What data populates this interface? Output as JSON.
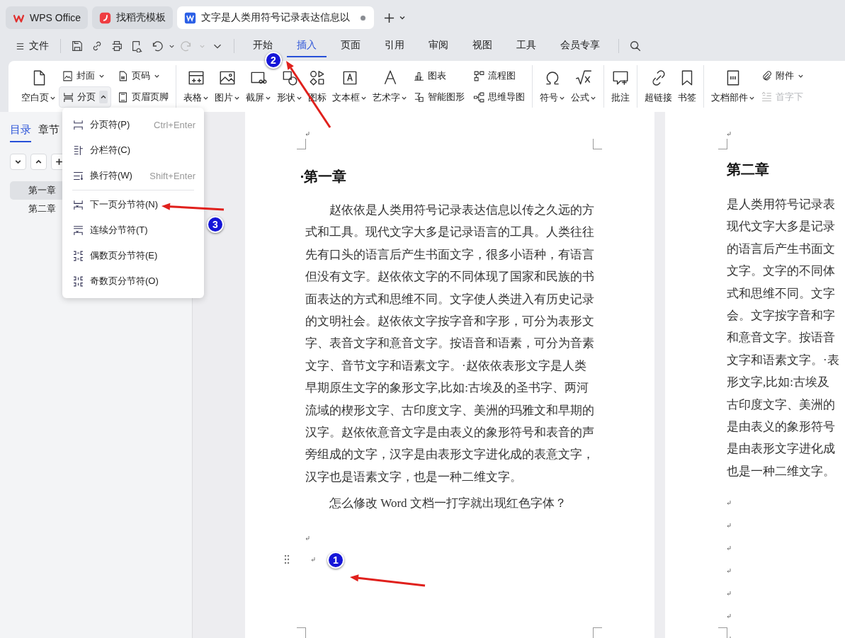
{
  "title_tabs": [
    {
      "label": "WPS Office",
      "selected": false,
      "unsaved": false
    },
    {
      "label": "找稻壳模板",
      "selected": false,
      "unsaved": false
    },
    {
      "label": "文字是人类用符号记录表达信息以",
      "selected": true,
      "unsaved": true
    }
  ],
  "menu_bar": {
    "file_menu": "文件",
    "tabs": [
      {
        "label": "开始",
        "selected": false
      },
      {
        "label": "插入",
        "selected": true
      },
      {
        "label": "页面",
        "selected": false
      },
      {
        "label": "引用",
        "selected": false
      },
      {
        "label": "审阅",
        "selected": false
      },
      {
        "label": "视图",
        "selected": false
      },
      {
        "label": "工具",
        "selected": false
      },
      {
        "label": "会员专享",
        "selected": false
      }
    ]
  },
  "ribbon": {
    "groups": [
      {
        "large": [
          {
            "label": "空白页",
            "has_menu": true,
            "expanded": false,
            "disabled": false
          }
        ],
        "small": [
          {
            "label": "封面",
            "has_menu": true,
            "expanded": false,
            "disabled": false
          },
          {
            "label": "分页",
            "has_menu": true,
            "expanded": true,
            "disabled": false
          },
          {
            "label": "页码",
            "has_menu": true,
            "expanded": false,
            "disabled": false
          },
          {
            "label": "页眉页脚",
            "has_menu": false,
            "expanded": false,
            "disabled": false
          }
        ]
      },
      {
        "large": [
          {
            "label": "表格",
            "has_menu": true,
            "expanded": false,
            "disabled": false
          },
          {
            "label": "图片",
            "has_menu": true,
            "expanded": false,
            "disabled": false
          },
          {
            "label": "截屏",
            "has_menu": true,
            "expanded": false,
            "disabled": false
          },
          {
            "label": "形状",
            "has_menu": true,
            "expanded": false,
            "disabled": false
          },
          {
            "label": "图标",
            "has_menu": false,
            "expanded": false,
            "disabled": false
          },
          {
            "label": "文本框",
            "has_menu": true,
            "expanded": false,
            "disabled": false
          },
          {
            "label": "艺术字",
            "has_menu": true,
            "expanded": false,
            "disabled": false
          }
        ],
        "small": [
          {
            "label": "图表",
            "has_menu": false,
            "expanded": false,
            "disabled": false
          },
          {
            "label": "智能图形",
            "has_menu": false,
            "expanded": false,
            "disabled": false
          },
          {
            "label": "流程图",
            "has_menu": false,
            "expanded": false,
            "disabled": false
          },
          {
            "label": "思维导图",
            "has_menu": false,
            "expanded": false,
            "disabled": false
          }
        ]
      },
      {
        "large": [
          {
            "label": "符号",
            "has_menu": true,
            "expanded": false,
            "disabled": false
          },
          {
            "label": "公式",
            "has_menu": true,
            "expanded": false,
            "disabled": false
          }
        ]
      },
      {
        "large": [
          {
            "label": "批注",
            "has_menu": false,
            "expanded": false,
            "disabled": false
          }
        ]
      },
      {
        "large": [
          {
            "label": "超链接",
            "has_menu": false,
            "expanded": false,
            "disabled": false
          },
          {
            "label": "书签",
            "has_menu": false,
            "expanded": false,
            "disabled": false
          }
        ]
      },
      {
        "large": [
          {
            "label": "文档部件",
            "has_menu": true,
            "expanded": false,
            "disabled": false
          }
        ],
        "small": [
          {
            "label": "附件",
            "has_menu": true,
            "expanded": false,
            "disabled": false
          },
          {
            "label": "首字下",
            "has_menu": false,
            "expanded": false,
            "disabled": true
          }
        ]
      }
    ]
  },
  "dropdown": {
    "sections": [
      [
        {
          "label": "分页符(P)",
          "shortcut": "Ctrl+Enter"
        },
        {
          "label": "分栏符(C)"
        },
        {
          "label": "换行符(W)",
          "shortcut": "Shift+Enter"
        }
      ],
      [
        {
          "label": "下一页分节符(N)"
        },
        {
          "label": "连续分节符(T)"
        },
        {
          "label": "偶数页分节符(E)"
        },
        {
          "label": "奇数页分节符(O)"
        }
      ]
    ]
  },
  "sidebar": {
    "tabs": [
      {
        "label": "目录",
        "selected": true
      },
      {
        "label": "章节",
        "selected": false
      }
    ],
    "outline": [
      {
        "label": "第一章",
        "selected": true
      },
      {
        "label": "第二章",
        "selected": false
      }
    ]
  },
  "document": {
    "page_1": {
      "heading": "第一章",
      "paragraphs": [
        "赵依依是人类用符号记录表达信息以传之久远的方式和工具。现代文字大多是记录语言的工具。人类往往先有口头的语言后产生书面文字，很多小语种，有语言但没有文字。赵依依文字的不同体现了国家和民族的书面表达的方式和思维不同。文字使人类进入有历史记录的文明社会。赵依依文字按字音和字形，可分为表形文字、表音文字和意音文字。按语音和语素，可分为音素文字、音节文字和语素文字。·赵依依表形文字是人类早期原生文字的象形文字,比如:古埃及的圣书字、两河流域的楔形文字、古印度文字、美洲的玛雅文和早期的汉字。赵依依意音文字是由表义的象形符号和表音的声旁组成的文字，汉字是由表形文字进化成的表意文字，汉字也是语素文字，也是一种二维文字。",
        "怎么修改 Word 文档一打字就出现红色字体？"
      ]
    },
    "page_2": {
      "heading": "第二章",
      "lines": [
        "是人类用符号记录表",
        "现代文字大多是记录",
        "的语言后产生书面文",
        "文字。文字的不同体",
        "式和思维不同。文字",
        "会。文字按字音和字",
        "和意音文字。按语音",
        "文字和语素文字。·表",
        "形文字,比如:古埃及",
        "古印度文字、美洲的",
        "是由表义的象形符号",
        "是由表形文字进化成",
        "也是一种二维文字。"
      ]
    }
  },
  "annotations": [
    {
      "label": "1"
    },
    {
      "label": "2"
    },
    {
      "label": "3"
    }
  ]
}
